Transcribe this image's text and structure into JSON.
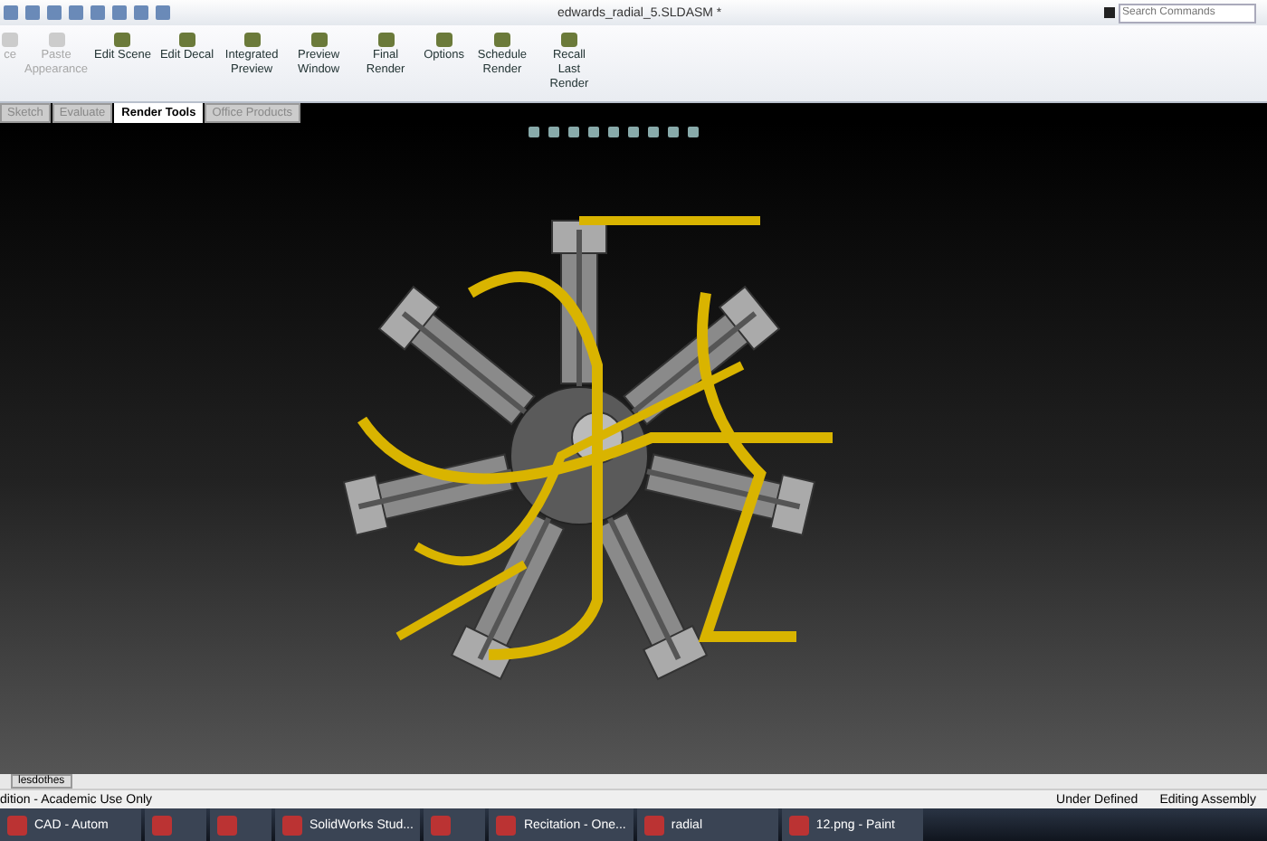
{
  "window": {
    "title": "edwards_radial_5.SLDASM *"
  },
  "search": {
    "placeholder": "Search Commands"
  },
  "ribbon": [
    {
      "label": "ce",
      "disabled": true
    },
    {
      "label": "Paste Appearance",
      "disabled": true
    },
    {
      "label": "Edit Scene",
      "disabled": false
    },
    {
      "label": "Edit Decal",
      "disabled": false
    },
    {
      "label": "Integrated Preview",
      "disabled": false
    },
    {
      "label": "Preview Window",
      "disabled": false
    },
    {
      "label": "Final Render",
      "disabled": false
    },
    {
      "label": "Options",
      "disabled": false
    },
    {
      "label": "Schedule Render",
      "disabled": false
    },
    {
      "label": "Recall Last Render",
      "disabled": false
    }
  ],
  "tabs": [
    {
      "label": "Sketch",
      "selected": false
    },
    {
      "label": "Evaluate",
      "selected": false
    },
    {
      "label": "Render Tools",
      "selected": true
    },
    {
      "label": "Office Products",
      "selected": false
    }
  ],
  "bottom_tab": {
    "label": "lesdothes"
  },
  "status_bar": {
    "left": "dition - Academic Use Only",
    "items": [
      "Under Defined",
      "Editing Assembly"
    ]
  },
  "taskbar": [
    {
      "kind": "labeled",
      "label": "CAD - Autom"
    },
    {
      "kind": "icon"
    },
    {
      "kind": "icon"
    },
    {
      "kind": "labeled",
      "label": "SolidWorks Stud..."
    },
    {
      "kind": "icon"
    },
    {
      "kind": "labeled",
      "label": "Recitation - One..."
    },
    {
      "kind": "labeled",
      "label": "radial"
    },
    {
      "kind": "labeled",
      "label": "12.png - Paint"
    }
  ]
}
